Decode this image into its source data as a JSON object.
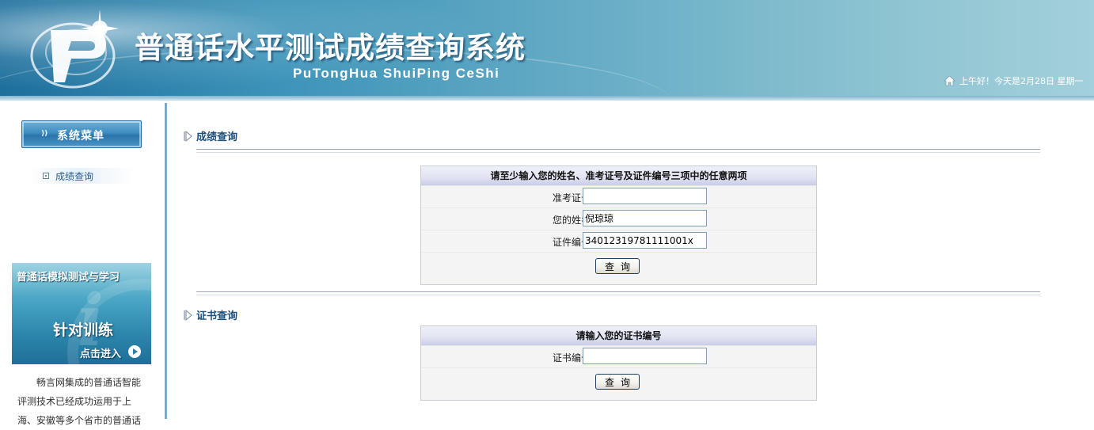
{
  "header": {
    "title": "普通话水平测试成绩查询系统",
    "subtitle": "PuTongHua ShuiPing CeShi",
    "greeting": "上午好！今天是2月28日  星期一"
  },
  "sidebar": {
    "menu_header": "系统菜单",
    "items": [
      {
        "label": "成绩查询"
      }
    ],
    "promo": {
      "title": "普通话模拟测试与学习",
      "subtitle": "针对训练",
      "enter": "点击进入"
    },
    "promo_text": "畅言网集成的普通话智能评测技术已经成功运用于上海、安徽等多个省市的普通话"
  },
  "score_query": {
    "section_title": "成绩查询",
    "panel_title": "请至少输入您的姓名、准考证号及证件编号三项中的任意两项",
    "fields": [
      {
        "label": "准考证号：",
        "value": ""
      },
      {
        "label": "您的姓名：",
        "value": "倪琼琼"
      },
      {
        "label": "证件编号：",
        "value": "34012319781111001x"
      }
    ],
    "button": "查询"
  },
  "cert_query": {
    "section_title": "证书查询",
    "panel_title": "请输入您的证书编号",
    "fields": [
      {
        "label": "证书编号：",
        "value": ""
      }
    ],
    "button": "查询"
  },
  "colors": {
    "header_dark": "#1d6f9c",
    "header_light": "#a3d0da",
    "section_title": "#1e4f7a",
    "panel_head": "#c9cce8",
    "menu_blue": "#3d8cc1"
  },
  "icons": [
    "logo-icon",
    "home-icon",
    "menu-header-icon",
    "bullet-icon",
    "play-icon",
    "section-arrow-icon"
  ]
}
